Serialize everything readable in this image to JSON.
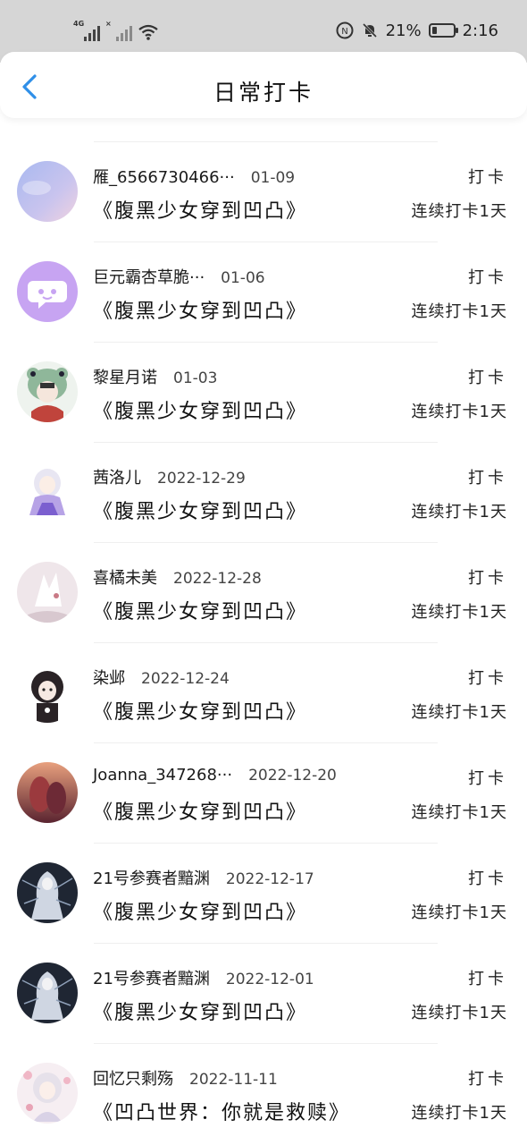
{
  "status_bar": {
    "network": "4G",
    "battery": "21%",
    "battery_level": 0.21,
    "time": "2:16"
  },
  "header": {
    "title": "日常打卡"
  },
  "colors": {
    "accent": "#2f8fe8",
    "status_bar_bg": "#d6d6d6"
  },
  "entries": [
    {
      "name": "雁_6566730466···",
      "date": "01-09",
      "book": "《腹黑少女穿到凹凸》",
      "action": "打卡",
      "streak": "连续打卡1天",
      "avatar_icon": "pastel-sky-avatar"
    },
    {
      "name": "巨元霸杏草脆···",
      "date": "01-06",
      "book": "《腹黑少女穿到凹凸》",
      "action": "打卡",
      "streak": "连续打卡1天",
      "avatar_icon": "chat-bubble-avatar"
    },
    {
      "name": "黎星月诺",
      "date": "01-03",
      "book": "《腹黑少女穿到凹凸》",
      "action": "打卡",
      "streak": "连续打卡1天",
      "avatar_icon": "frog-hat-girl-avatar"
    },
    {
      "name": "茜洛儿",
      "date": "2022-12-29",
      "book": "《腹黑少女穿到凹凸》",
      "action": "打卡",
      "streak": "连续打卡1天",
      "avatar_icon": "anime-girl-avatar"
    },
    {
      "name": "喜橘未美",
      "date": "2022-12-28",
      "book": "《腹黑少女穿到凹凸》",
      "action": "打卡",
      "streak": "连续打卡1天",
      "avatar_icon": "white-wolf-avatar"
    },
    {
      "name": "染邺",
      "date": "2022-12-24",
      "book": "《腹黑少女穿到凹凸》",
      "action": "打卡",
      "streak": "连续打卡1天",
      "avatar_icon": "dark-hair-girl-avatar"
    },
    {
      "name": "Joanna_347268···",
      "date": "2022-12-20",
      "book": "《腹黑少女穿到凹凸》",
      "action": "打卡",
      "streak": "连续打卡1天",
      "avatar_icon": "red-scene-avatar"
    },
    {
      "name": "21号参赛者黯渊",
      "date": "2022-12-17",
      "book": "《腹黑少女穿到凹凸》",
      "action": "打卡",
      "streak": "连续打卡1天",
      "avatar_icon": "dark-figure-avatar"
    },
    {
      "name": "21号参赛者黯渊",
      "date": "2022-12-01",
      "book": "《腹黑少女穿到凹凸》",
      "action": "打卡",
      "streak": "连续打卡1天",
      "avatar_icon": "dark-figure-avatar"
    },
    {
      "name": "回忆只剩殇",
      "date": "2022-11-11",
      "book": "《凹凸世界：你就是救赎》",
      "action": "打卡",
      "streak": "连续打卡1天",
      "avatar_icon": "blossom-girl-avatar"
    }
  ]
}
